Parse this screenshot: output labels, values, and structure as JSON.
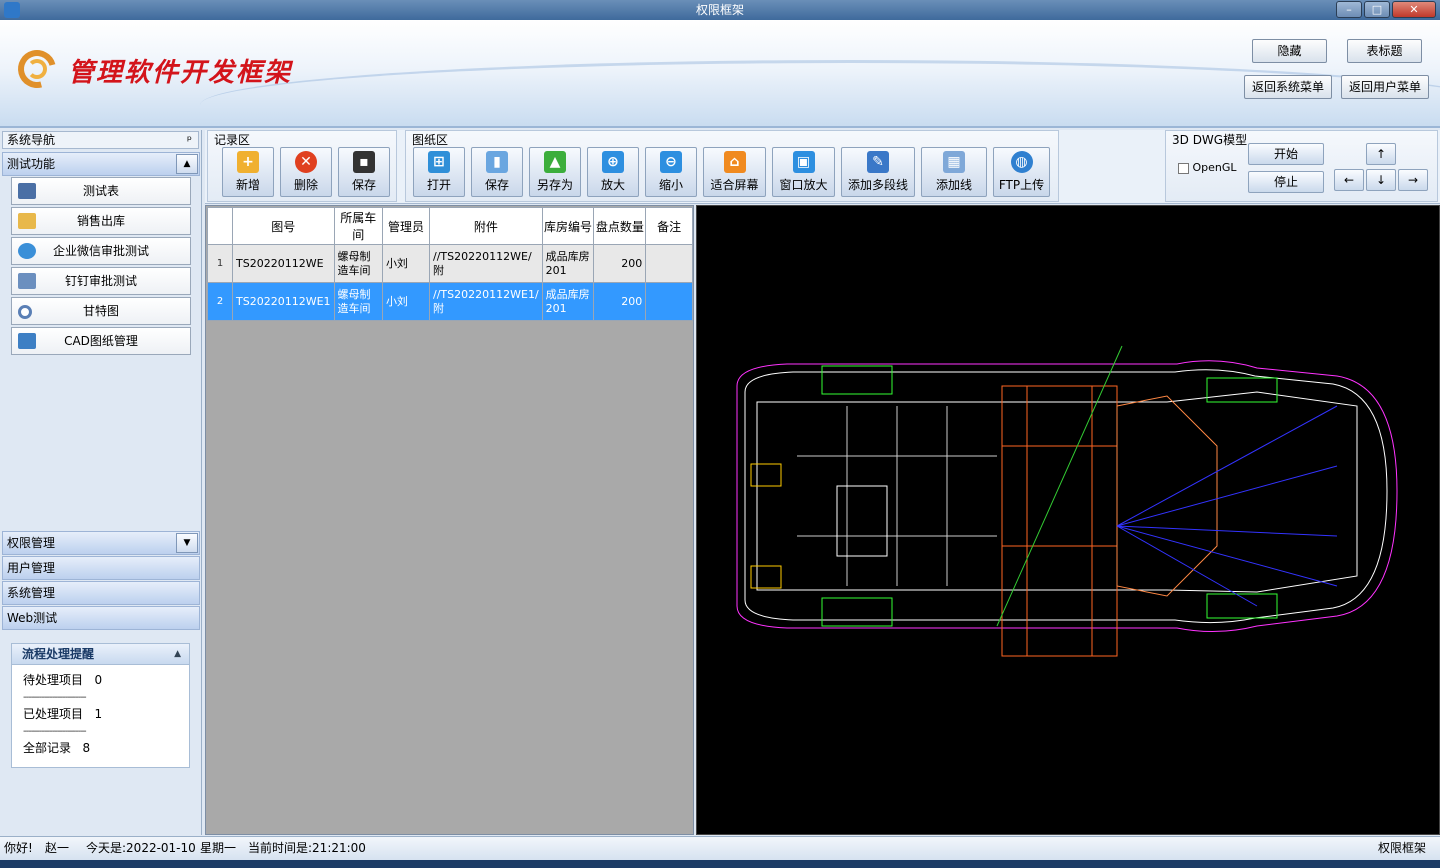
{
  "window": {
    "title": "权限框架"
  },
  "banner": {
    "brand": "管理软件开发框架",
    "hide_btn": "隐藏",
    "table_btn": "表标题",
    "back_sys": "返回系统菜单",
    "back_user": "返回用户菜单"
  },
  "nav": {
    "header": "系统导航",
    "pin": "ᵖ",
    "test_group": "测试功能",
    "items": [
      {
        "label": "测试表",
        "icon": "table-icon"
      },
      {
        "label": "销售出库",
        "icon": "notes-icon"
      },
      {
        "label": "企业微信审批测试",
        "icon": "globe-icon"
      },
      {
        "label": "钉钉审批测试",
        "icon": "chart-icon"
      },
      {
        "label": "甘特图",
        "icon": "target-icon"
      },
      {
        "label": "CAD图纸管理",
        "icon": "monitor-icon"
      }
    ],
    "groups": [
      "权限管理",
      "用户管理",
      "系统管理",
      "Web测试"
    ]
  },
  "workflow": {
    "title": "流程处理提醒",
    "pending_label": "待处理项目",
    "pending_count": "0",
    "separator": "------------------------",
    "done_label": "已处理项目",
    "done_count": "1",
    "all_label": "全部记录",
    "all_count": "8"
  },
  "toolbar": {
    "record_section": "记录区",
    "record_buttons": [
      "新增",
      "删除",
      "保存"
    ],
    "drawing_section": "图纸区",
    "drawing_buttons": [
      "打开",
      "保存",
      "另存为",
      "放大",
      "缩小",
      "适合屏幕",
      "窗口放大",
      "添加多段线",
      "添加线",
      "FTP上传"
    ],
    "dwg_section": "3D DWG模型",
    "opengl_label": "OpenGL",
    "start_btn": "开始",
    "stop_btn": "停止",
    "arrows": {
      "up": "↑",
      "left": "←",
      "down": "↓",
      "right": "→"
    }
  },
  "grid": {
    "columns": [
      "图号",
      "所属车间",
      "管理员",
      "附件",
      "库房编号",
      "盘点数量",
      "备注"
    ],
    "rows": [
      {
        "n": "1",
        "cells": [
          "TS20220112WE",
          "螺母制造车间",
          "小刘",
          "//TS20220112WE/附",
          "成品库房201",
          "200",
          ""
        ]
      },
      {
        "n": "2",
        "cells": [
          "TS20220112WE1",
          "螺母制造车间",
          "小刘",
          "//TS20220112WE1/附",
          "成品库房201",
          "200",
          ""
        ]
      }
    ]
  },
  "status": {
    "greeting": "你好!",
    "user": "赵一",
    "date_label": "今天是:2022-01-10",
    "weekday": "星期一",
    "time_label": "当前时间是:21:21:00",
    "app_name": "权限框架"
  },
  "colors": {
    "accent": "#3399ff",
    "brand": "#d3141b"
  }
}
